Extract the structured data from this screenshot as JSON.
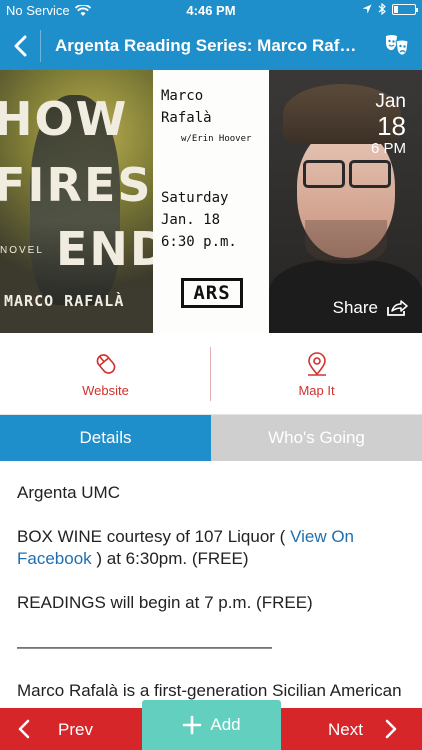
{
  "status_bar": {
    "carrier": "No Service",
    "time": "4:46 PM"
  },
  "nav": {
    "title": "Argenta Reading Series: Marco Rafalà..."
  },
  "hero": {
    "book_cover": {
      "title_line1": "HOW",
      "title_line2": "FIRES",
      "title_line3": "END",
      "novel_label": "NOVEL",
      "author": "MARCO RAFALÀ"
    },
    "flyer": {
      "name_line1": "Marco",
      "name_line2": "Rafalà",
      "with_line": "w/Erin Hoover",
      "day": "Saturday",
      "date": "Jan. 18",
      "time": "6:30 p.m.",
      "logo": "ARS"
    },
    "date_badge": {
      "month": "Jan",
      "day": "18",
      "hour": "6 PM"
    },
    "share_label": "Share"
  },
  "actions": {
    "website_label": "Website",
    "map_label": "Map It",
    "accent_color": "#d0312d"
  },
  "tabs": {
    "details_label": "Details",
    "whos_going_label": "Who's Going"
  },
  "content": {
    "venue": "Argenta UMC",
    "box_wine_prefix": "BOX WINE courtesy of 107 Liquor ( ",
    "view_on_facebook": "View On Facebook",
    "box_wine_suffix": " ) at 6:30pm. (FREE)",
    "readings": "READINGS will begin at 7 p.m. (FREE)",
    "divider": "———————————————",
    "bio_start": "Marco Rafalà is a first-generation Sicilian American"
  },
  "bottom_bar": {
    "prev_label": "Prev",
    "add_label": "Add",
    "next_label": "Next"
  },
  "colors": {
    "primary_blue": "#1e8fcb",
    "bottom_red": "#d6262a",
    "add_teal": "#63d0bf",
    "inactive_tab": "#cfcfcf"
  }
}
